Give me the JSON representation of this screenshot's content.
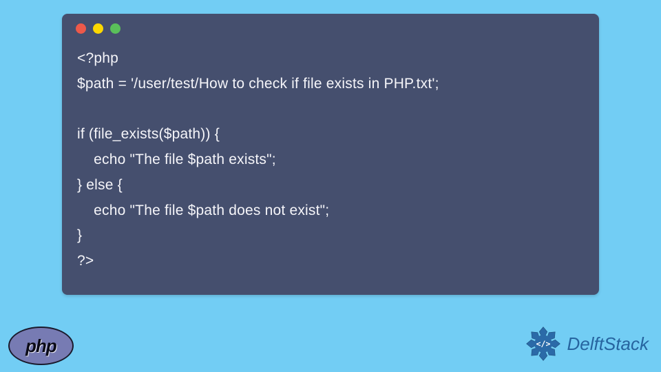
{
  "code": {
    "line1": "<?php",
    "line2": "$path = '/user/test/How to check if file exists in PHP.txt';",
    "line3": "",
    "line4": "if (file_exists($path)) {",
    "line5": "    echo \"The file $path exists\";",
    "line6": "} else {",
    "line7": "    echo \"The file $path does not exist\";",
    "line8": "}",
    "line9": "?>"
  },
  "logos": {
    "php_label": "php",
    "delft_label": "DelftStack"
  },
  "colors": {
    "page_bg": "#72cdf4",
    "window_bg": "#454f6e",
    "code_color": "#f5f5f9",
    "php_bg": "#777bb3",
    "delft_color": "#26649f"
  }
}
